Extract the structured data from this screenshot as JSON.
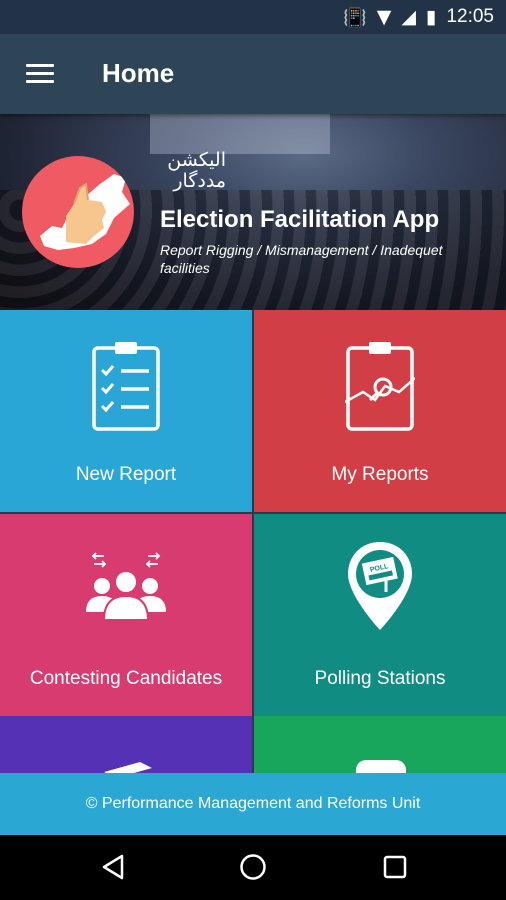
{
  "status_bar": {
    "time": "12:05"
  },
  "app_bar": {
    "title": "Home"
  },
  "banner": {
    "urdu_line1": "الیکشن",
    "urdu_line2": "مددگار",
    "title": "Election Facilitation App",
    "subtitle": "Report Rigging / Mismanagement / Inadequet facilities"
  },
  "tiles": [
    {
      "label": "New Report",
      "color": "#29a6d6",
      "icon": "clipboard-checklist-icon"
    },
    {
      "label": "My Reports",
      "color": "#d13e45",
      "icon": "clipboard-chart-icon"
    },
    {
      "label": "Contesting Candidates",
      "color": "#d83b70",
      "icon": "candidates-group-icon"
    },
    {
      "label": "Polling Stations",
      "color": "#108c83",
      "icon": "polling-location-icon"
    },
    {
      "label": "",
      "color": "#5531b6",
      "icon": "graduation-cap-icon"
    },
    {
      "label": "",
      "color": "#17a65b",
      "icon": "chat-bubble-icon"
    }
  ],
  "footer": {
    "text": "©  Performance Management and Reforms Unit"
  },
  "colors": {
    "status_bar": "#233347",
    "app_bar": "#2e4457",
    "footer": "#2aa7d3"
  }
}
